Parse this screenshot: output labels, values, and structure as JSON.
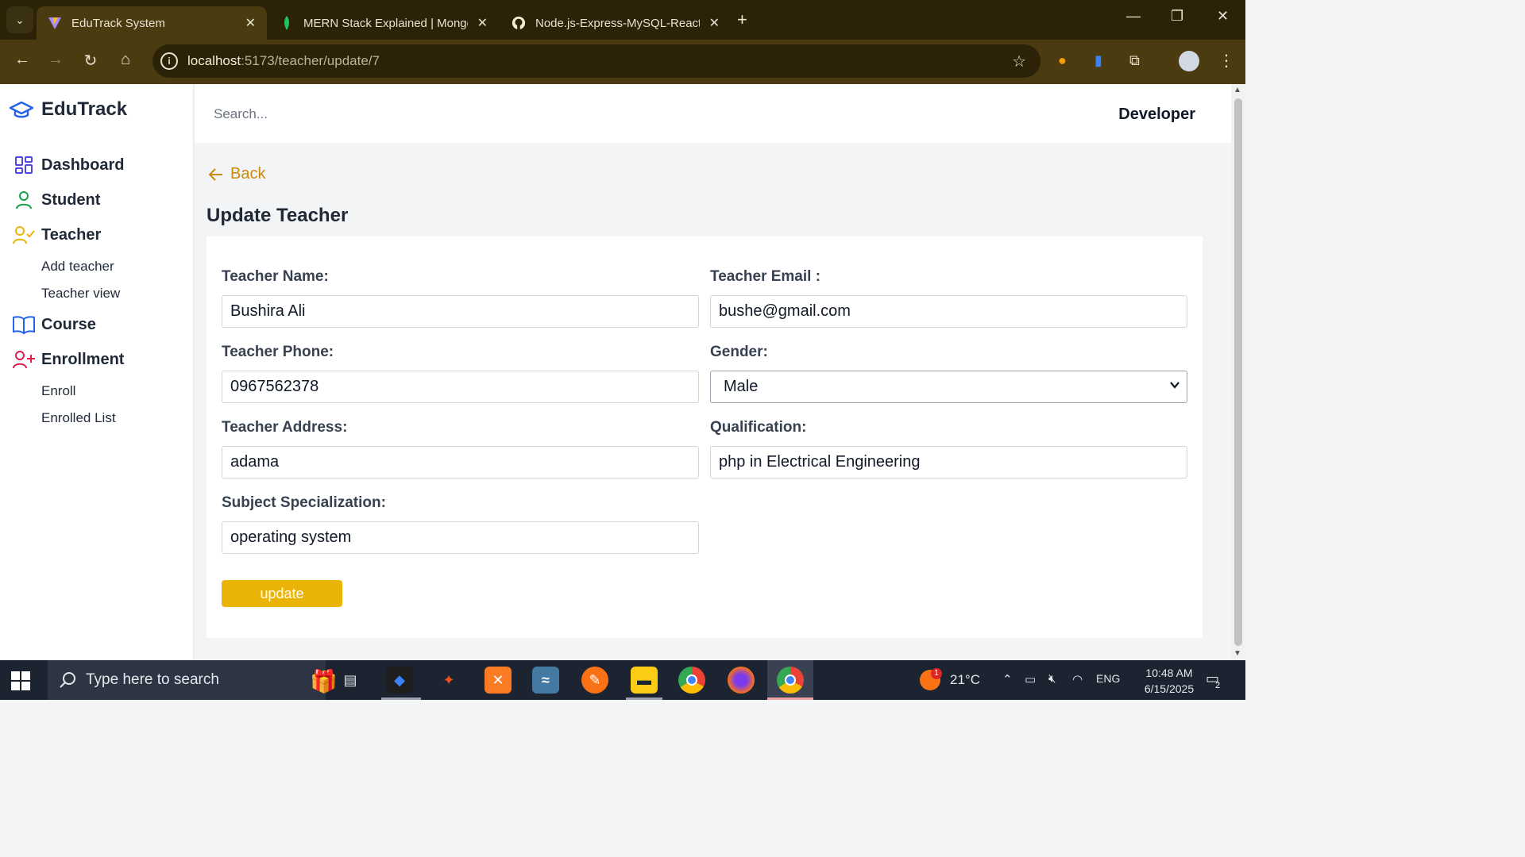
{
  "browser": {
    "tabs": [
      {
        "title": "EduTrack System",
        "active": true
      },
      {
        "title": "MERN Stack Explained | Mongo",
        "active": false
      },
      {
        "title": "Node.js-Express-MySQL-React-",
        "active": false
      }
    ],
    "url_host": "localhost",
    "url_path": ":5173/teacher/update/7"
  },
  "sidebar": {
    "brand": "EduTrack",
    "items": [
      {
        "label": "Dashboard",
        "icon": "grid-icon",
        "color": "#4f46e5"
      },
      {
        "label": "Student",
        "icon": "user-icon",
        "color": "#16a34a"
      },
      {
        "label": "Teacher",
        "icon": "user-check-icon",
        "color": "#eab308"
      },
      {
        "label": "Course",
        "icon": "book-icon",
        "color": "#2563eb"
      },
      {
        "label": "Enrollment",
        "icon": "user-plus-icon",
        "color": "#e11d48"
      }
    ],
    "teacher_sub": [
      "Add teacher",
      "Teacher view"
    ],
    "enrollment_sub": [
      "Enroll",
      "Enrolled List"
    ]
  },
  "header": {
    "search_placeholder": "Search...",
    "user": "Developer"
  },
  "page": {
    "back": "Back",
    "title": "Update Teacher",
    "fields": {
      "name_label": "Teacher Name:",
      "name_value": "Bushira Ali",
      "email_label": "Teacher Email :",
      "email_value": "bushe@gmail.com",
      "phone_label": "Teacher Phone:",
      "phone_value": "0967562378",
      "gender_label": "Gender:",
      "gender_value": "Male",
      "address_label": "Teacher Address:",
      "address_value": "adama",
      "qualification_label": "Qualification:",
      "qualification_value": "php in Electrical Engineering",
      "specialization_label": "Subject Specialization:",
      "specialization_value": "operating system"
    },
    "submit": "update",
    "accent": "#eab308"
  },
  "taskbar": {
    "search_text": "Type here to search",
    "weather": "21°C",
    "weather_badge": "1",
    "lang": "ENG",
    "time": "10:48 AM",
    "date": "6/15/2025",
    "notif_count": "2"
  }
}
